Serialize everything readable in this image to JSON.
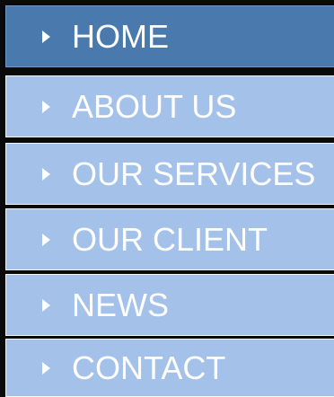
{
  "menu": {
    "items": [
      {
        "label": "HOME",
        "active": true
      },
      {
        "label": "ABOUT US",
        "active": false
      },
      {
        "label": "OUR SERVICES",
        "active": false
      },
      {
        "label": "OUR CLIENT",
        "active": false
      },
      {
        "label": "NEWS",
        "active": false
      },
      {
        "label": "CONTACT",
        "active": false
      }
    ]
  },
  "colors": {
    "active_background": "#4a79ad",
    "inactive_background": "#a3c1e9",
    "text": "#ffffff",
    "separator": "#0a0a0a"
  },
  "icons": {
    "item_marker": "triangle-right-icon"
  }
}
